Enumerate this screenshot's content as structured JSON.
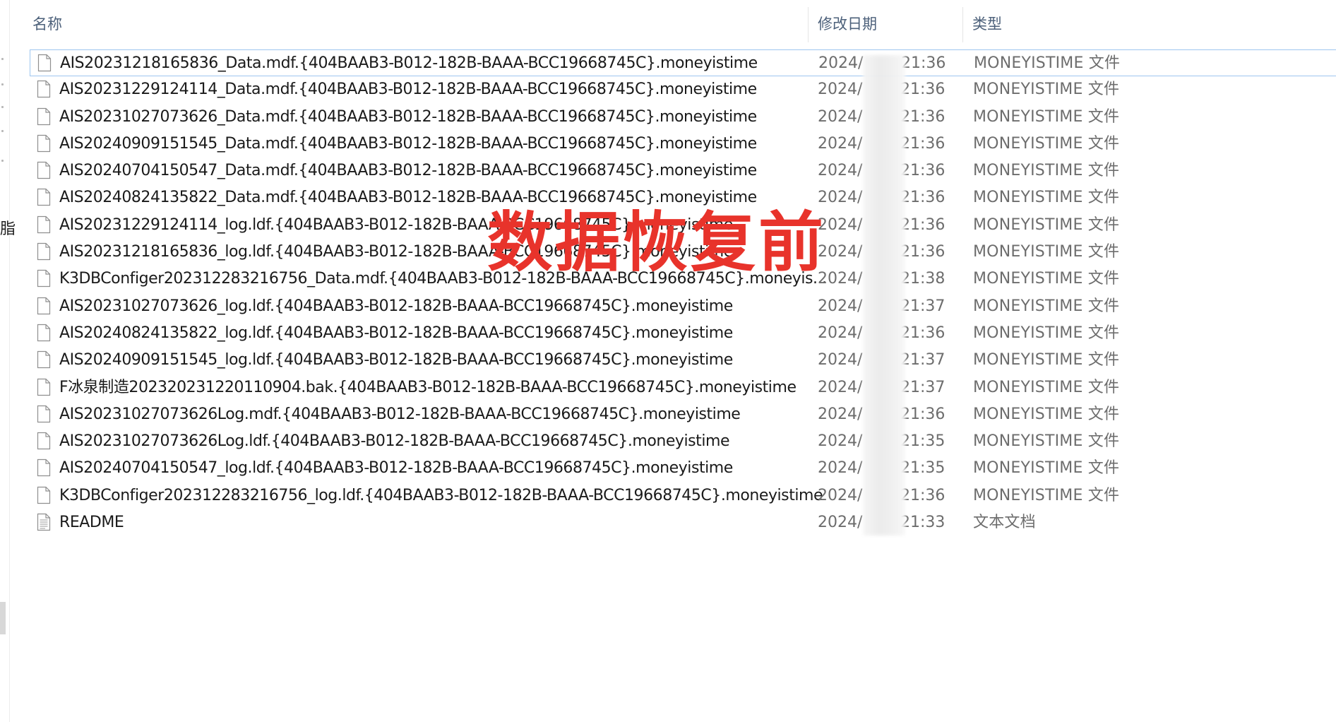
{
  "nav_pane": {
    "partial_text": "脂"
  },
  "columns": {
    "name": "名称",
    "date_modified": "修改日期",
    "type": "类型"
  },
  "files": [
    {
      "name": "AIS20231218165836_Data.mdf.{404BAAB3-B012-182B-BAAA-BCC19668745C}.moneyistime",
      "date_prefix": "2024/",
      "time_suffix": "21:36",
      "type": "MONEYISTIME 文件",
      "icon": "blank-file-icon"
    },
    {
      "name": "AIS20231229124114_Data.mdf.{404BAAB3-B012-182B-BAAA-BCC19668745C}.moneyistime",
      "date_prefix": "2024/",
      "time_suffix": "21:36",
      "type": "MONEYISTIME 文件",
      "icon": "blank-file-icon"
    },
    {
      "name": "AIS20231027073626_Data.mdf.{404BAAB3-B012-182B-BAAA-BCC19668745C}.moneyistime",
      "date_prefix": "2024/",
      "time_suffix": "21:36",
      "type": "MONEYISTIME 文件",
      "icon": "blank-file-icon"
    },
    {
      "name": "AIS20240909151545_Data.mdf.{404BAAB3-B012-182B-BAAA-BCC19668745C}.moneyistime",
      "date_prefix": "2024/",
      "time_suffix": "21:36",
      "type": "MONEYISTIME 文件",
      "icon": "blank-file-icon"
    },
    {
      "name": "AIS20240704150547_Data.mdf.{404BAAB3-B012-182B-BAAA-BCC19668745C}.moneyistime",
      "date_prefix": "2024/",
      "time_suffix": "21:36",
      "type": "MONEYISTIME 文件",
      "icon": "blank-file-icon"
    },
    {
      "name": "AIS20240824135822_Data.mdf.{404BAAB3-B012-182B-BAAA-BCC19668745C}.moneyistime",
      "date_prefix": "2024/",
      "time_suffix": "21:36",
      "type": "MONEYISTIME 文件",
      "icon": "blank-file-icon"
    },
    {
      "name": "AIS20231229124114_log.ldf.{404BAAB3-B012-182B-BAAA-BCC19668745C}.moneyistime",
      "date_prefix": "2024/",
      "time_suffix": "21:36",
      "type": "MONEYISTIME 文件",
      "icon": "blank-file-icon"
    },
    {
      "name": "AIS20231218165836_log.ldf.{404BAAB3-B012-182B-BAAA-BCC19668745C}.moneyistime",
      "date_prefix": "2024/",
      "time_suffix": "21:36",
      "type": "MONEYISTIME 文件",
      "icon": "blank-file-icon"
    },
    {
      "name": "K3DBConfiger202312283216756_Data.mdf.{404BAAB3-B012-182B-BAAA-BCC19668745C}.moneyis...",
      "date_prefix": "2024/",
      "time_suffix": "21:38",
      "type": "MONEYISTIME 文件",
      "icon": "blank-file-icon"
    },
    {
      "name": "AIS20231027073626_log.ldf.{404BAAB3-B012-182B-BAAA-BCC19668745C}.moneyistime",
      "date_prefix": "2024/",
      "time_suffix": "21:37",
      "type": "MONEYISTIME 文件",
      "icon": "blank-file-icon"
    },
    {
      "name": "AIS20240824135822_log.ldf.{404BAAB3-B012-182B-BAAA-BCC19668745C}.moneyistime",
      "date_prefix": "2024/",
      "time_suffix": "21:36",
      "type": "MONEYISTIME 文件",
      "icon": "blank-file-icon"
    },
    {
      "name": "AIS20240909151545_log.ldf.{404BAAB3-B012-182B-BAAA-BCC19668745C}.moneyistime",
      "date_prefix": "2024/",
      "time_suffix": "21:37",
      "type": "MONEYISTIME 文件",
      "icon": "blank-file-icon"
    },
    {
      "name": "F冰泉制造202320231220110904.bak.{404BAAB3-B012-182B-BAAA-BCC19668745C}.moneyistime",
      "date_prefix": "2024/",
      "time_suffix": "21:37",
      "type": "MONEYISTIME 文件",
      "icon": "blank-file-icon"
    },
    {
      "name": "AIS20231027073626Log.mdf.{404BAAB3-B012-182B-BAAA-BCC19668745C}.moneyistime",
      "date_prefix": "2024/",
      "time_suffix": "21:36",
      "type": "MONEYISTIME 文件",
      "icon": "blank-file-icon"
    },
    {
      "name": "AIS20231027073626Log.ldf.{404BAAB3-B012-182B-BAAA-BCC19668745C}.moneyistime",
      "date_prefix": "2024/",
      "time_suffix": "21:35",
      "type": "MONEYISTIME 文件",
      "icon": "blank-file-icon"
    },
    {
      "name": "AIS20240704150547_log.ldf.{404BAAB3-B012-182B-BAAA-BCC19668745C}.moneyistime",
      "date_prefix": "2024/",
      "time_suffix": "21:35",
      "type": "MONEYISTIME 文件",
      "icon": "blank-file-icon"
    },
    {
      "name": "K3DBConfiger202312283216756_log.ldf.{404BAAB3-B012-182B-BAAA-BCC19668745C}.moneyistime",
      "date_prefix": "2024/",
      "time_suffix": "21:36",
      "type": "MONEYISTIME 文件",
      "icon": "blank-file-icon"
    },
    {
      "name": "README",
      "date_prefix": "2024/",
      "time_suffix": "21:33",
      "type": "文本文档",
      "icon": "text-document-icon"
    }
  ],
  "overlay": {
    "label": "数据恢复前",
    "color": "#e8332b"
  },
  "colors": {
    "header_text": "#4c607a",
    "selection_border": "#9ec6f0",
    "secondary_text": "#6d6d6d"
  }
}
